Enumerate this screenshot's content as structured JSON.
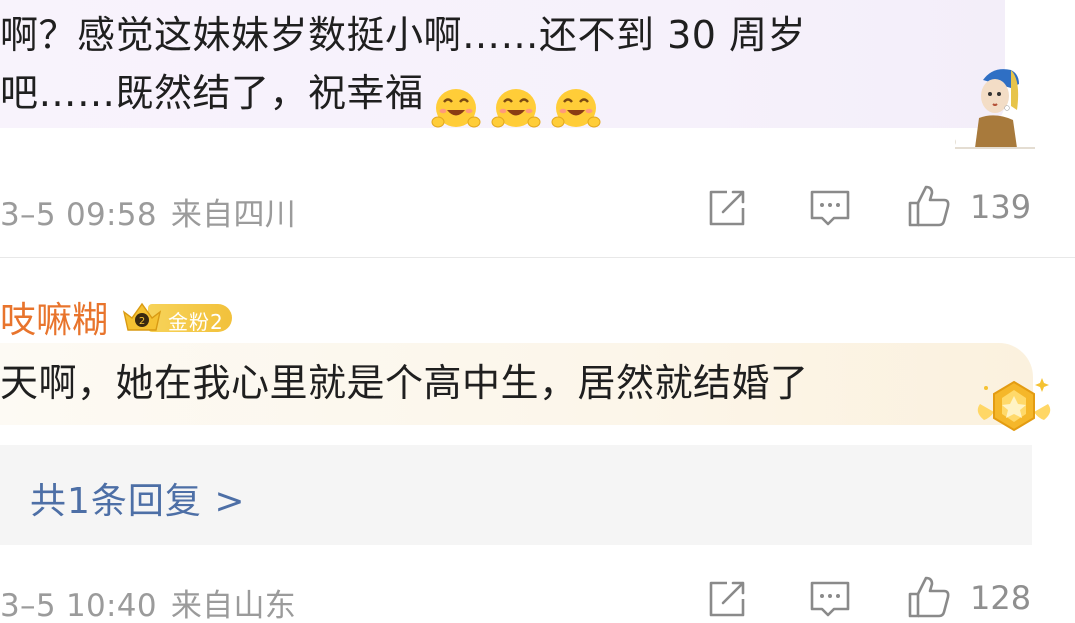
{
  "comments": [
    {
      "text_line1": "啊？感觉这妹妹岁数挺小啊……还不到 30 周岁",
      "text_line2": "吧……既然结了，祝幸福",
      "emojis": [
        "laughing-hug-emoji",
        "laughing-hug-emoji",
        "laughing-hug-emoji"
      ],
      "sticker": "pearl-earring-girl-sticker",
      "time": "3–5 09:58",
      "location": "来自四川",
      "likes": "139"
    },
    {
      "author": "吱嘛糊",
      "fan_badge": "金粉2",
      "text": "天啊，她在我心里就是个高中生，居然就结婚了",
      "reply_summary": "共1条回复 >",
      "time": "3–5 10:40",
      "location": "来自山东",
      "likes": "128"
    }
  ],
  "actions": {
    "share_icon": "share-icon",
    "comment_icon": "comment-icon",
    "like_icon": "thumbs-up-icon"
  },
  "colors": {
    "author": "#e8742c",
    "reply_link": "#4d6fa6",
    "meta_text": "#9b9b9b",
    "badge_gold": "#f2c13b"
  }
}
